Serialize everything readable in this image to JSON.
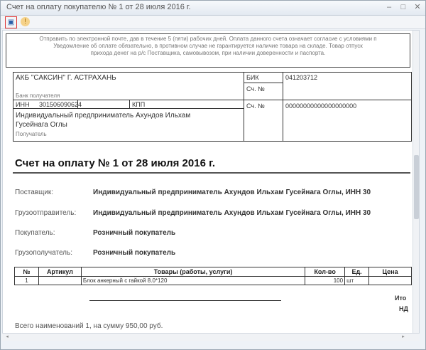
{
  "window": {
    "title": "Счет на оплату покупателю № 1 от 28 июля 2016 г.",
    "buttons": {
      "minimize": "–",
      "maximize": "□",
      "close": "✕"
    }
  },
  "toolbar": {
    "print_icon": "▣",
    "info_icon": "!"
  },
  "notice": {
    "line1": "Отправить по электронной почте, дав в течение 5 (пяти) рабочих дней. Оплата данного счета означает согласие с условиями п",
    "line2": "Уведомление об оплате обязательно, в противном случае не гарантируется наличие товара на складе. Товар отпуск",
    "line3": "прихода денег на р/с Поставщика, самовывозом, при наличии доверенности и паспорта."
  },
  "bank": {
    "name": "АКБ \"САКСИН\" Г. АСТРАХАНЬ",
    "bik_label": "БИК",
    "bik_value": "041203712",
    "acc_label1": "Сч. №",
    "bank_label": "Банк получателя",
    "inn_label": "ИНН",
    "inn_value": "301506090624",
    "kpp_label": "КПП",
    "acc_label2": "Сч. №",
    "acc_value": "00000000000000000000",
    "recipient_line1": "Индивидуальный предприниматель Ахундов Ильхам",
    "recipient_line2": "Гусейнага Оглы",
    "recipient_label": "Получатель"
  },
  "invoice": {
    "title": "Счет на оплату № 1 от 28 июля 2016 г."
  },
  "parties": [
    {
      "label": "Поставщик:",
      "value": "Индивидуальный предприниматель Ахундов Ильхам Гусейнага Оглы, ИНН 30"
    },
    {
      "label": "Грузоотправитель:",
      "value": "Индивидуальный предприниматель Ахундов Ильхам Гусейнага Оглы, ИНН 30"
    },
    {
      "label": "Покупатель:",
      "value": "Розничный покупатель"
    },
    {
      "label": "Грузополучатель:",
      "value": "Розничный покупатель"
    }
  ],
  "items": {
    "headers": [
      "№",
      "Артикул",
      "Товары (работы, услуги)",
      "Кол-во",
      "Ед.",
      "Цена"
    ],
    "rows": [
      [
        "1",
        "",
        "Блок анкерный с гайкой 8.0*120",
        "100",
        "шт",
        ""
      ]
    ]
  },
  "totals": {
    "itogo": "Ито",
    "nds": "НД"
  },
  "summary": {
    "text": "Всего наименований 1, на сумму 950,00 руб."
  },
  "scroll": {
    "left_arrow": "◂",
    "right_arrow": "▸"
  }
}
